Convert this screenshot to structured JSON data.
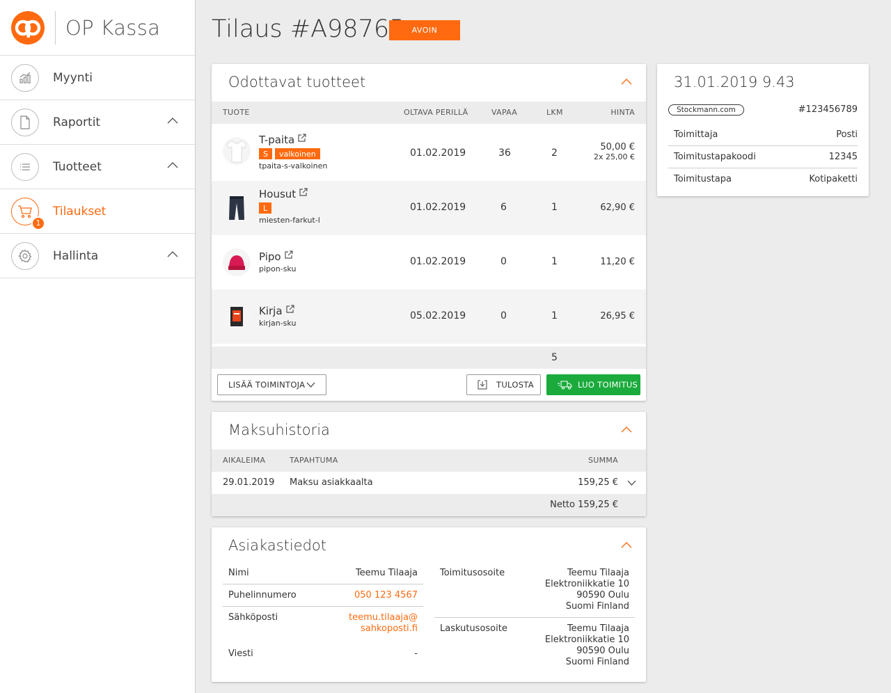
{
  "app": {
    "title": "OP Kassa"
  },
  "nav": [
    {
      "label": "Myynti",
      "icon": "sales-chart-icon"
    },
    {
      "label": "Raportit",
      "icon": "document-icon"
    },
    {
      "label": "Tuotteet",
      "icon": "list-icon"
    },
    {
      "label": "Tilaukset",
      "icon": "cart-icon",
      "badge": "1",
      "active": true
    },
    {
      "label": "Hallinta",
      "icon": "gear-icon"
    }
  ],
  "header": {
    "title": "Tilaus #A98765",
    "status": "AVOIN"
  },
  "products": {
    "title": "Odottavat tuotteet",
    "columns": {
      "product": "TUOTE",
      "waiting": "OLTAVA PERILLÄ",
      "free": "VAPAA",
      "qty": "LKM",
      "price": "HINTA"
    },
    "rows": [
      {
        "name": "T-paita",
        "tags": [
          "S",
          "valkoinen"
        ],
        "sku": "tpaita-s-valkoinen",
        "date": "01.02.2019",
        "free": "36",
        "qty": "2",
        "price": "50,00 €",
        "price_sub": "2x 25,00 €"
      },
      {
        "name": "Housut",
        "tags": [
          "L"
        ],
        "sku": "miesten-farkut-l",
        "date": "01.02.2019",
        "free": "6",
        "qty": "1",
        "price": "62,90 €",
        "price_sub": ""
      },
      {
        "name": "Pipo",
        "tags": [],
        "sku": "pipon-sku",
        "date": "01.02.2019",
        "free": "0",
        "qty": "1",
        "price": "11,20 €",
        "price_sub": ""
      },
      {
        "name": "Kirja",
        "tags": [],
        "sku": "kirjan-sku",
        "date": "05.02.2019",
        "free": "0",
        "qty": "1",
        "price": "26,95 €",
        "price_sub": ""
      }
    ],
    "total_qty": "5",
    "more_actions": "LISÄÄ TOIMINTOJA",
    "print": "TULOSTA",
    "create_delivery": "LUO TOIMITUS"
  },
  "payments": {
    "title": "Maksuhistoria",
    "columns": {
      "time": "AIKALEIMA",
      "event": "TAPAHTUMA",
      "sum": "SUMMA"
    },
    "row": {
      "date": "29.01.2019",
      "event": "Maksu asiakkaalta",
      "sum": "159,25 €"
    },
    "net": "Netto 159,25 €"
  },
  "customer": {
    "title": "Asiakastiedot",
    "name_label": "Nimi",
    "name": "Teemu Tilaaja",
    "phone_label": "Puhelinnumero",
    "phone": "050 123 4567",
    "email_label": "Sähköposti",
    "email_1": "teemu.tilaaja@",
    "email_2": "sahkoposti.fi",
    "message_label": "Viesti",
    "message": "-",
    "delivery_label": "Toimitusosoite",
    "delivery": [
      "Teemu Tilaaja",
      "Elektroniikkatie 10",
      "90590 Oulu",
      "Suomi Finland"
    ],
    "billing_label": "Laskutusosoite",
    "billing": [
      "Teemu Tilaaja",
      "Elektroniikkatie 10",
      "90590 Oulu",
      "Suomi Finland"
    ]
  },
  "info": {
    "date": "31.01.2019 9.43",
    "shop": "Stockmann.com",
    "order_no": "#123456789",
    "supplier_label": "Toimittaja",
    "supplier": "Posti",
    "code_label": "Toimitustapakoodi",
    "code": "12345",
    "method_label": "Toimitustapa",
    "method": "Kotipaketti"
  },
  "colors": {
    "accent": "#ff6a10",
    "success": "#1aab3c",
    "table_header": "#ececec"
  }
}
